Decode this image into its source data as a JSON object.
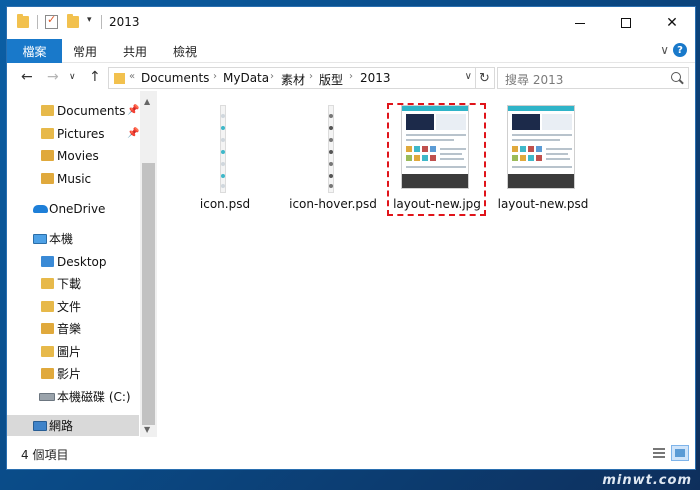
{
  "window": {
    "title": "2013"
  },
  "window_controls": {
    "minimize": "minimize",
    "maximize": "maximize",
    "close": "✕"
  },
  "ribbon": {
    "file_tab": "檔案",
    "tabs": [
      "常用",
      "共用",
      "檢視"
    ],
    "expand": "∨",
    "help": "?"
  },
  "address": {
    "back": "←",
    "forward": "→",
    "recent": "∨",
    "up": "↑",
    "crumbs": [
      "Documents",
      "MyData",
      "素材",
      "版型",
      "2013"
    ],
    "dropdown": "∨",
    "refresh": "↻"
  },
  "search": {
    "placeholder": "搜尋 2013"
  },
  "nav": {
    "quick_access": [
      {
        "label": "Documents",
        "icon": "documents-folder-icon",
        "pinned": true
      },
      {
        "label": "Pictures",
        "icon": "pictures-folder-icon",
        "pinned": true
      },
      {
        "label": "Movies",
        "icon": "movies-folder-icon",
        "pinned": false
      },
      {
        "label": "Music",
        "icon": "music-folder-icon",
        "pinned": false
      }
    ],
    "onedrive": "OneDrive",
    "this_pc": "本機",
    "pc_items": [
      "Desktop",
      "下載",
      "文件",
      "音樂",
      "圖片",
      "影片",
      "本機磁碟 (C:)"
    ],
    "network": "網路",
    "pin_icon": "📌"
  },
  "files": [
    {
      "name": "icon.psd",
      "kind": "strip"
    },
    {
      "name": "icon-hover.psd",
      "kind": "strip-dark"
    },
    {
      "name": "layout-new.jpg",
      "kind": "page",
      "highlighted": true
    },
    {
      "name": "layout-new.psd",
      "kind": "page"
    }
  ],
  "status": {
    "item_count": "4 個項目"
  },
  "colors": {
    "accent": "#1979ca",
    "highlight_dash": "#e0141a",
    "folder": "#f2c14e",
    "selected_nav": "#d9d9d9"
  }
}
